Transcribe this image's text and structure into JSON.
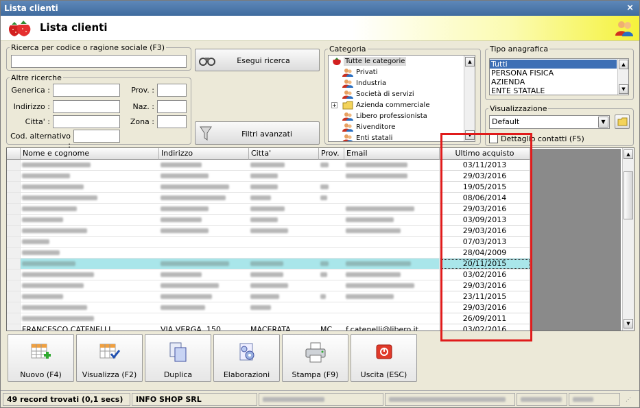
{
  "window": {
    "title": "Lista clienti",
    "close_glyph": "×"
  },
  "header": {
    "title": "Lista clienti",
    "logo_icon": "strawberry-icon",
    "users_icon": "users-icon"
  },
  "search": {
    "group_label": "Ricerca per codice o ragione sociale (F3)",
    "value": "",
    "run_label": "Esegui ricerca",
    "run_icon": "binoculars-icon",
    "advanced_label": "Filtri avanzati",
    "advanced_icon": "funnel-icon"
  },
  "other_search": {
    "group_label": "Altre ricerche",
    "generica": "Generica :",
    "indirizzo": "Indirizzo :",
    "citta": "Citta' :",
    "cod_alt": "Cod. alternativo :",
    "prov": "Prov. :",
    "naz": "Naz. :",
    "zona": "Zona :"
  },
  "category": {
    "group_label": "Categoria",
    "items": [
      {
        "label": "Tutte le categorie",
        "icon": "strawberry-icon",
        "selected": true,
        "expand": false
      },
      {
        "label": "Privati",
        "icon": "users-icon",
        "expand": false
      },
      {
        "label": "Industria",
        "icon": "users-icon",
        "expand": false
      },
      {
        "label": "Società di servizi",
        "icon": "users-icon",
        "expand": false
      },
      {
        "label": "Azienda commerciale",
        "icon": "folder-icon",
        "expand": true
      },
      {
        "label": "Libero professionista",
        "icon": "users-icon",
        "expand": false
      },
      {
        "label": "Rivenditore",
        "icon": "users-icon",
        "expand": false
      },
      {
        "label": "Enti statali",
        "icon": "users-icon",
        "expand": false
      }
    ]
  },
  "tipo": {
    "group_label": "Tipo anagrafica",
    "items": [
      "Tutti",
      "PERSONA FISICA",
      "AZIENDA",
      "ENTE STATALE"
    ],
    "selected": "Tutti"
  },
  "view": {
    "group_label": "Visualizzazione",
    "selected": "Default",
    "detail_label": "Dettaglio contatti (F5)",
    "detail_checked": false
  },
  "grid": {
    "columns": [
      "Nome e cognome",
      "Indirizzo",
      "Citta'",
      "Prov.",
      "Email",
      "Ultimo acquisto"
    ],
    "dates": [
      "03/11/2013",
      "29/03/2016",
      "19/05/2015",
      "08/06/2014",
      "29/03/2016",
      "03/09/2013",
      "29/03/2016",
      "07/03/2013",
      "28/04/2009",
      "20/11/2015",
      "03/02/2016",
      "29/03/2016",
      "23/11/2015",
      "29/03/2016",
      "26/09/2011",
      "03/02/2016"
    ],
    "selected_row": 9,
    "last_row": {
      "name": "FRANCESCO CATENELLI",
      "address": "VIA VERGA, 150",
      "city": "MACERATA",
      "prov": "MC",
      "email": "f.catenelli@libero.it"
    }
  },
  "toolbar": [
    {
      "label": "Nuovo (F4)",
      "icon": "new-grid-icon"
    },
    {
      "label": "Visualizza (F2)",
      "icon": "view-grid-icon"
    },
    {
      "label": "Duplica",
      "icon": "duplicate-icon"
    },
    {
      "label": "Elaborazioni",
      "icon": "process-icon"
    },
    {
      "label": "Stampa (F9)",
      "icon": "printer-icon"
    },
    {
      "label": "Uscita (ESC)",
      "icon": "exit-icon"
    }
  ],
  "status": {
    "records": "49 record trovati (0,1 secs)",
    "company": "INFO SHOP SRL"
  },
  "colors": {
    "accent_selection": "#a9e6ea",
    "highlight_border": "#e01b1b",
    "list_selection": "#3d6fb5"
  }
}
